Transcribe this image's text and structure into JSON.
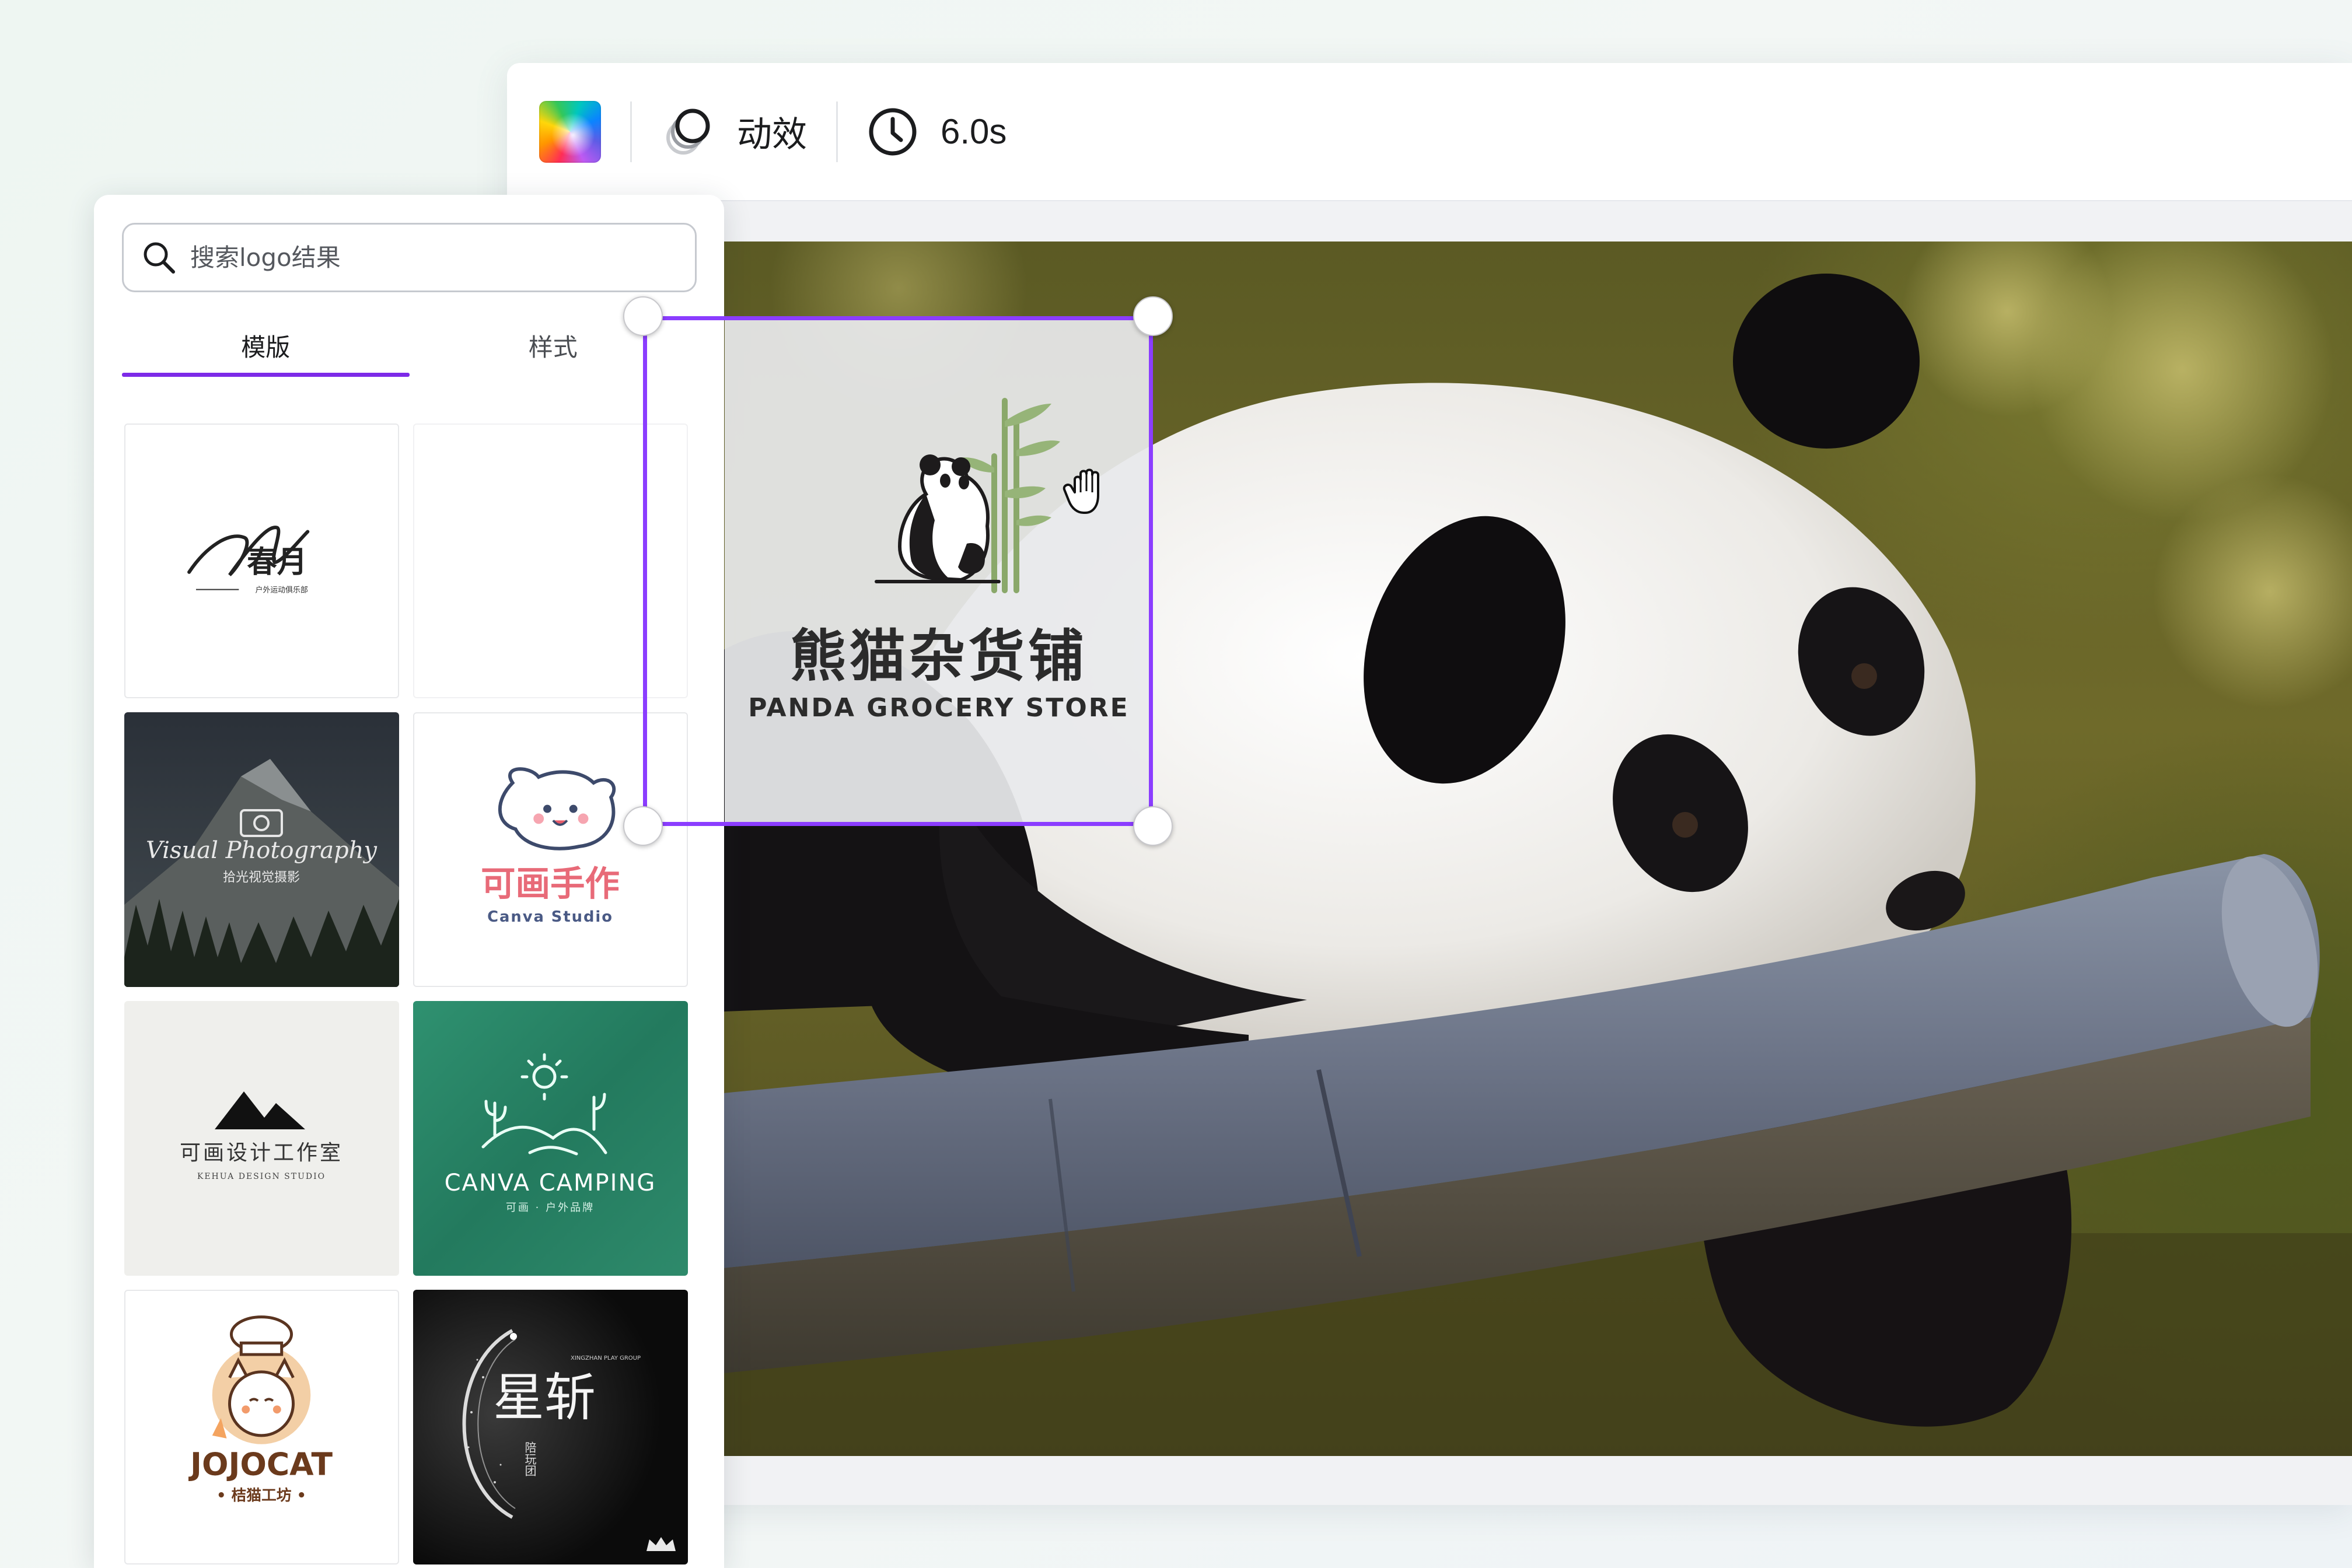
{
  "toolbar": {
    "color_icon": "color-palette-icon",
    "animate_icon": "animate-icon",
    "animate_label": "动效",
    "timer_icon": "clock-icon",
    "duration_label": "6.0s"
  },
  "panel": {
    "search": {
      "placeholder": "搜索logo结果",
      "value": ""
    },
    "tabs": [
      {
        "label": "模版",
        "active": true
      },
      {
        "label": "样式",
        "active": false
      }
    ],
    "templates": [
      {
        "name": "chunyue",
        "title": "春月",
        "subtitle": "户外运动俱乐部"
      },
      {
        "name": "blank",
        "title": ""
      },
      {
        "name": "visual-photography",
        "title": "Visual Photography",
        "subtitle": "拾光视觉摄影"
      },
      {
        "name": "canva-studio",
        "title": "可画手作",
        "subtitle": "Canva Studio"
      },
      {
        "name": "kehua-design",
        "title": "可画设计工作室",
        "subtitle": "KEHUA DESIGN STUDIO"
      },
      {
        "name": "canva-camping",
        "title": "CANVA CAMPING",
        "subtitle": "可画 · 户外品牌"
      },
      {
        "name": "jojocat",
        "title": "JOJOCAT",
        "subtitle": "• 桔猫工坊 •"
      },
      {
        "name": "xingzhan",
        "title": "星斩",
        "subtitle": "陪玩团",
        "en": "XINGZHAN PLAY GROUP",
        "premium": true
      }
    ]
  },
  "logo": {
    "title_cn": "熊猫杂货铺",
    "title_en": "PANDA GROCERY STORE"
  },
  "colors": {
    "accent": "#8b3dff",
    "tab_underline": "#7d2ae8",
    "camping_green": "#2e8a6b",
    "jojocat_brown": "#6b3a1c"
  }
}
